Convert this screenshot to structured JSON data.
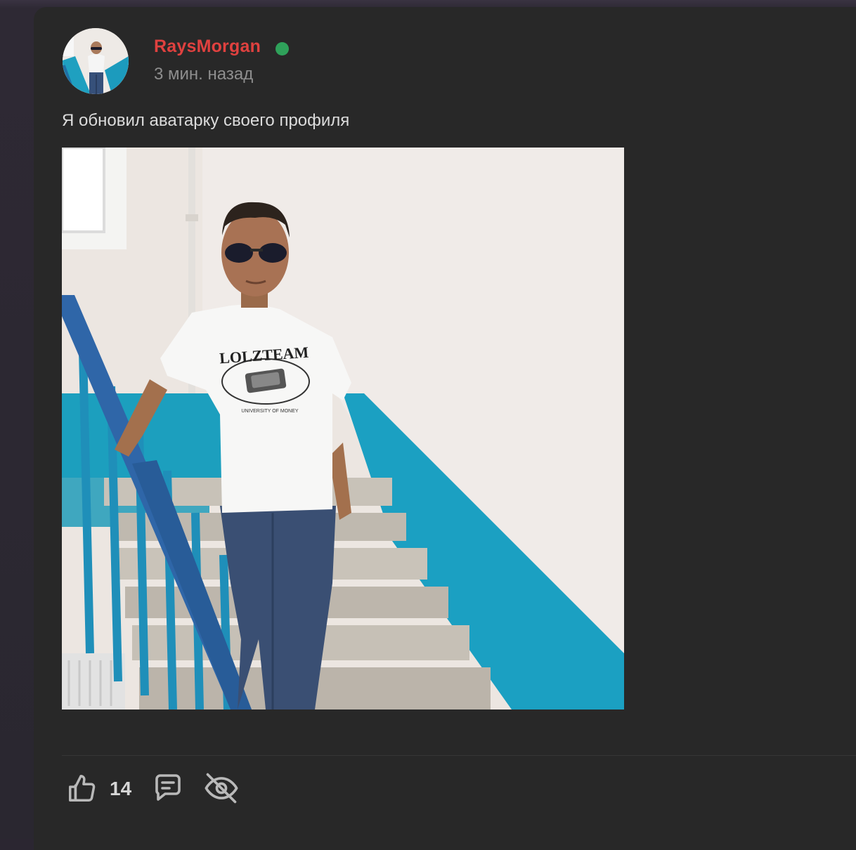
{
  "post": {
    "author": "RaysMorgan",
    "time": "3 мин. назад",
    "text": "Я обновил аватарку своего профиля",
    "image": {
      "shirt_brand": "LOLZTEAM",
      "shirt_tagline": "UNIVERSITY OF MONEY"
    },
    "likes": "14"
  },
  "colors": {
    "page_bg": "#2b2631",
    "card_bg": "#282828",
    "username": "#e0413f",
    "online": "#2fa15a",
    "timestamp": "#8e8e8e",
    "text": "#dcdcdc",
    "icon": "#b9b9b9",
    "wall_teal": "#1c9fc0"
  },
  "icons": {
    "like": "thumbs-up-icon",
    "comment": "comment-icon",
    "hide": "eye-off-icon",
    "online": "online-status-dot"
  }
}
